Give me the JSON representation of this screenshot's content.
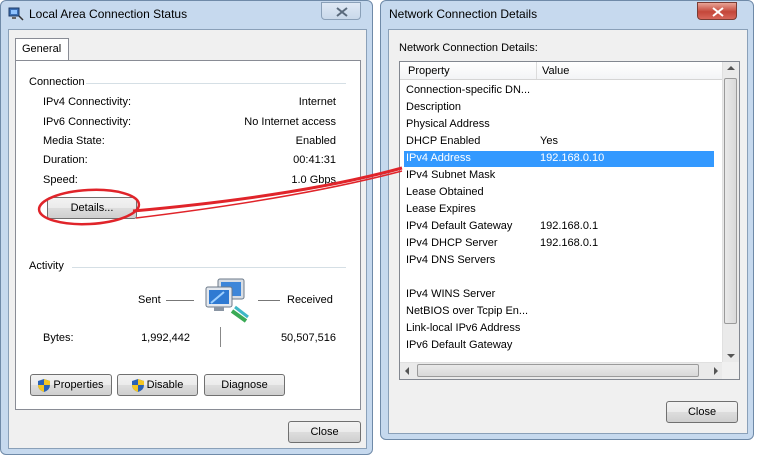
{
  "left_window": {
    "title": "Local Area Connection Status",
    "tab_label": "General",
    "connection": {
      "group_label": "Connection",
      "rows": [
        {
          "label": "IPv4 Connectivity:",
          "value": "Internet"
        },
        {
          "label": "IPv6 Connectivity:",
          "value": "No Internet access"
        },
        {
          "label": "Media State:",
          "value": "Enabled"
        },
        {
          "label": "Duration:",
          "value": "00:41:31"
        },
        {
          "label": "Speed:",
          "value": "1.0 Gbps"
        }
      ],
      "details_label": "Details..."
    },
    "activity": {
      "group_label": "Activity",
      "sent_label": "Sent",
      "received_label": "Received",
      "bytes_label": "Bytes:",
      "bytes_sent": "1,992,442",
      "bytes_received": "50,507,516"
    },
    "buttons": {
      "properties": "Properties",
      "disable": "Disable",
      "diagnose": "Diagnose",
      "close": "Close"
    }
  },
  "right_window": {
    "title": "Network Connection Details",
    "list_label": "Network Connection Details:",
    "columns": {
      "property": "Property",
      "value": "Value"
    },
    "rows": [
      {
        "property": "Connection-specific DN...",
        "value": ""
      },
      {
        "property": "Description",
        "value": ""
      },
      {
        "property": "Physical Address",
        "value": ""
      },
      {
        "property": "DHCP Enabled",
        "value": "Yes"
      },
      {
        "property": "IPv4 Address",
        "value": "192.168.0.10"
      },
      {
        "property": "IPv4 Subnet Mask",
        "value": ""
      },
      {
        "property": "Lease Obtained",
        "value": ""
      },
      {
        "property": "Lease Expires",
        "value": ""
      },
      {
        "property": "IPv4 Default Gateway",
        "value": "192.168.0.1"
      },
      {
        "property": "IPv4 DHCP Server",
        "value": "192.168.0.1"
      },
      {
        "property": "IPv4 DNS Servers",
        "value": ""
      },
      {
        "property": "",
        "value": ""
      },
      {
        "property": "IPv4 WINS Server",
        "value": ""
      },
      {
        "property": "NetBIOS over Tcpip En...",
        "value": ""
      },
      {
        "property": "Link-local IPv6 Address",
        "value": ""
      },
      {
        "property": "IPv6 Default Gateway",
        "value": ""
      }
    ],
    "selected_row": "IPv4 Address",
    "close_label": "Close"
  },
  "icons": {
    "window_icon": "network-adapter-icon",
    "shield": "uac-shield-icon",
    "activity": "network-computers-icon"
  },
  "colors": {
    "selection": "#3399ff",
    "annotation": "#e0242a",
    "close_button": "#c4473a"
  }
}
